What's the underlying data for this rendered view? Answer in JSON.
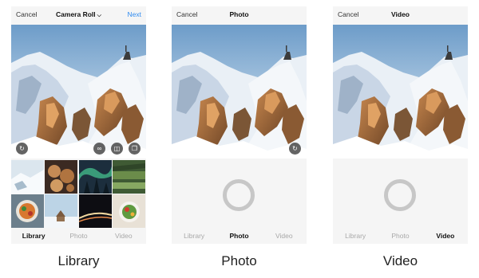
{
  "screens": {
    "library": {
      "cancel": "Cancel",
      "title": "Camera Roll",
      "next": "Next",
      "tabs": [
        "Library",
        "Photo",
        "Video"
      ],
      "active_tab": "Library",
      "caption": "Library",
      "overlay_icons": [
        "rotate-icon",
        "infinity-icon",
        "layout-icon",
        "multi-select-icon"
      ]
    },
    "photo": {
      "cancel": "Cancel",
      "title": "Photo",
      "tabs": [
        "Library",
        "Photo",
        "Video"
      ],
      "active_tab": "Photo",
      "caption": "Photo",
      "overlay_icons": [
        "flip-camera-icon"
      ]
    },
    "video": {
      "cancel": "Cancel",
      "title": "Video",
      "tabs": [
        "Library",
        "Photo",
        "Video"
      ],
      "active_tab": "Video",
      "caption": "Video"
    }
  },
  "thumbnails": [
    "snowy-landscape",
    "cookies",
    "aurora-night",
    "green-field",
    "food-bowl",
    "winter-hut",
    "light-trails",
    "salad-plate"
  ],
  "colors": {
    "accent": "#2f8bf0",
    "ring": "#c7c7c7",
    "panel": "#f5f5f5"
  }
}
